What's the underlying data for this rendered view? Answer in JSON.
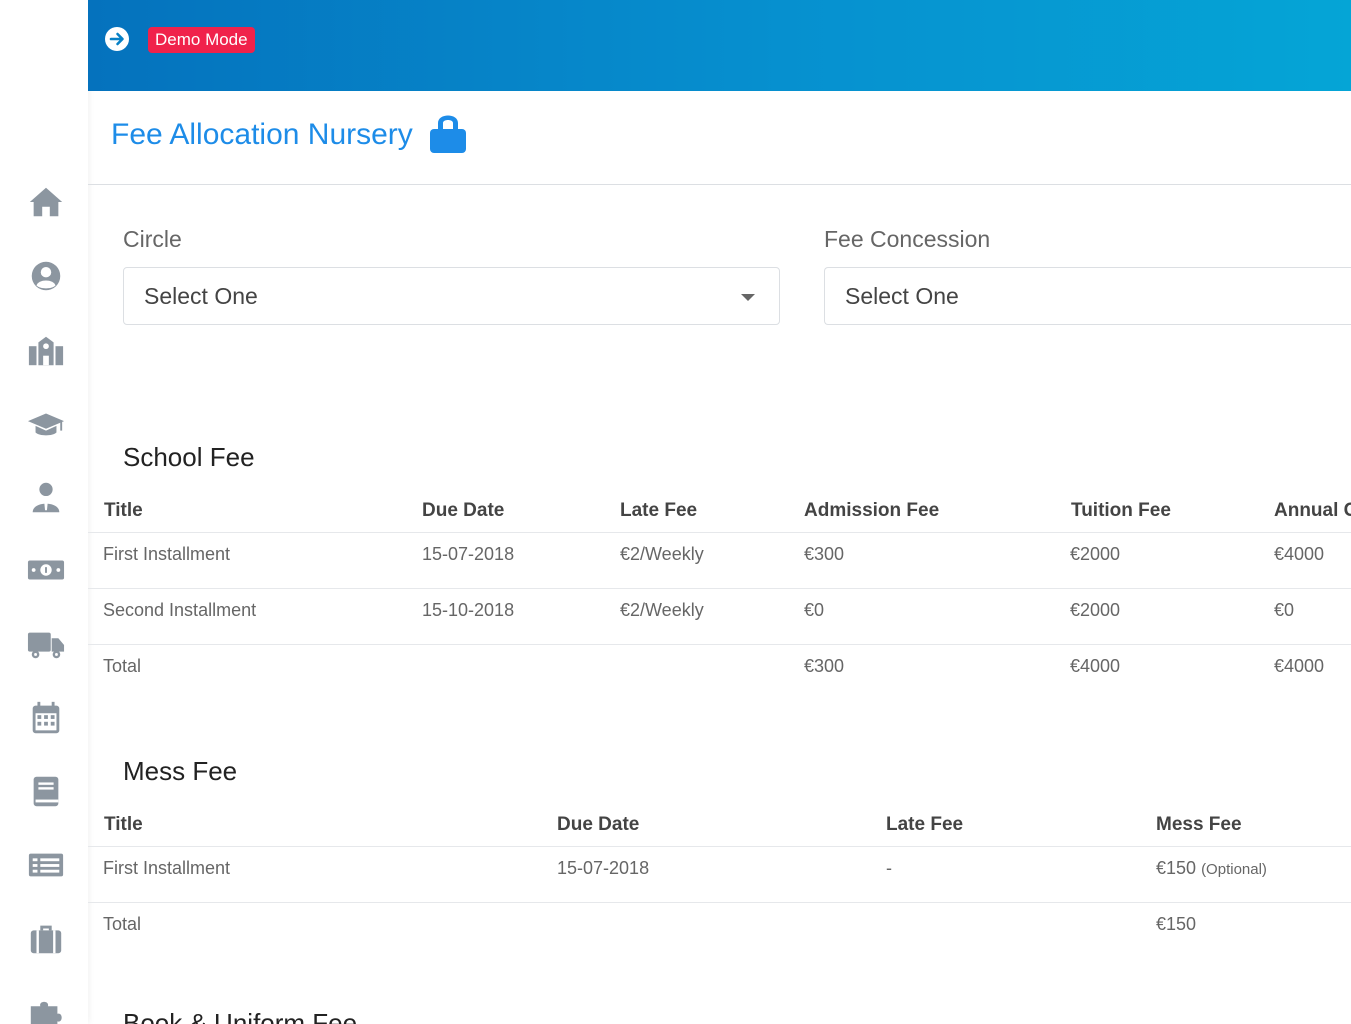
{
  "sidebar": {
    "icons": [
      "home-icon",
      "user-circle-icon",
      "school-icon",
      "graduation-cap-icon",
      "teacher-icon",
      "money-icon",
      "truck-icon",
      "calendar-icon",
      "book-icon",
      "list-icon",
      "briefcase-icon",
      "puzzle-icon"
    ]
  },
  "topbar": {
    "badge": "Demo Mode",
    "colors": {
      "gradient_start": "#0572bd",
      "gradient_end": "#05a5d6",
      "badge": "#f0224b"
    }
  },
  "page": {
    "title": "Fee Allocation Nursery",
    "title_color": "#1d8ce8"
  },
  "filters": {
    "circle": {
      "label": "Circle",
      "value": "Select One"
    },
    "concession": {
      "label": "Fee Concession",
      "value": "Select One"
    }
  },
  "school_fee": {
    "title": "School Fee",
    "headers": [
      "Title",
      "Due Date",
      "Late Fee",
      "Admission Fee",
      "Tuition Fee",
      "Annual C"
    ],
    "rows": [
      [
        "First Installment",
        "15-07-2018",
        "€2/Weekly",
        "€300",
        "€2000",
        "€4000"
      ],
      [
        "Second Installment",
        "15-10-2018",
        "€2/Weekly",
        "€0",
        "€2000",
        "€0"
      ],
      [
        "Total",
        "",
        "",
        "€300",
        "€4000",
        "€4000"
      ]
    ]
  },
  "mess_fee": {
    "title": "Mess Fee",
    "headers": [
      "Title",
      "Due Date",
      "Late Fee",
      "Mess Fee"
    ],
    "rows": [
      [
        "First Installment",
        "15-07-2018",
        "-",
        "€150"
      ],
      [
        "Total",
        "",
        "",
        "€150"
      ]
    ],
    "optional_note": "(Optional)"
  },
  "book_fee": {
    "title": "Book & Uniform Fee"
  }
}
